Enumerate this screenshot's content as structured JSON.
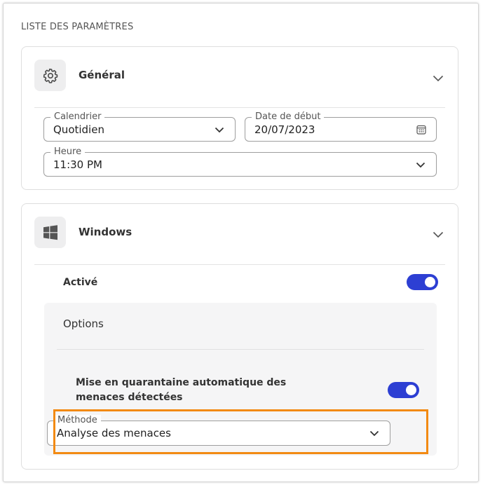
{
  "section_title": "LISTE DES PARAMÈTRES",
  "general": {
    "title": "Général",
    "icon": "gear-icon",
    "calendar": {
      "label": "Calendrier",
      "value": "Quotidien"
    },
    "start_date": {
      "label": "Date de début",
      "value": "20/07/2023"
    },
    "time": {
      "label": "Heure",
      "value": "11:30 PM"
    }
  },
  "windows": {
    "title": "Windows",
    "icon": "windows-logo-icon",
    "enabled_label": "Activé",
    "enabled": true,
    "options_label": "Options",
    "quarantine_label": "Mise en quarantaine automatique des menaces détectées",
    "quarantine_enabled": true,
    "method": {
      "label": "Méthode",
      "value": "Analyse des menaces"
    }
  },
  "colors": {
    "toggle_on": "#2d3fd3",
    "highlight": "#f28a13"
  }
}
